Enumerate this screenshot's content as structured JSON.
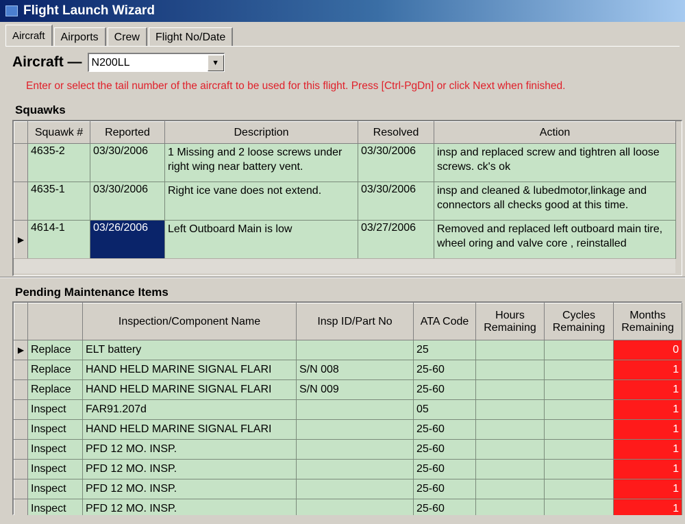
{
  "window": {
    "title": "Flight Launch Wizard"
  },
  "tabs": [
    {
      "label": "Aircraft"
    },
    {
      "label": "Airports"
    },
    {
      "label": "Crew"
    },
    {
      "label": "Flight No/Date"
    }
  ],
  "aircraft": {
    "label": "Aircraft —",
    "selected": "N200LL",
    "hint": "Enter or select the tail number of the aircraft to be used for this flight. Press [Ctrl-PgDn] or click Next when finished."
  },
  "squawks": {
    "title": "Squawks",
    "columns": [
      "Squawk #",
      "Reported",
      "Description",
      "Resolved",
      "Action"
    ],
    "rows": [
      {
        "id": "4635-2",
        "reported": "03/30/2006",
        "description": "1 Missing and 2 loose screws under right wing near battery vent.",
        "resolved": "03/30/2006",
        "action": "insp and replaced  screw and tightren all loose screws. ck's ok"
      },
      {
        "id": "4635-1",
        "reported": "03/30/2006",
        "description": "Right ice vane does not extend.",
        "resolved": "03/30/2006",
        "action": "insp and cleaned & lubedmotor,linkage and connectors all checks good at this time."
      },
      {
        "id": "4614-1",
        "reported": "03/26/2006",
        "description": "Left Outboard Main is low",
        "resolved": "03/27/2006",
        "action": "Removed and replaced left outboard main tire, wheel oring and valve core , reinstalled"
      }
    ]
  },
  "maintenance": {
    "title": "Pending Maintenance Items",
    "columns": [
      "",
      "Inspection/Component Name",
      "Insp ID/Part No",
      "ATA Code",
      "Hours Remaining",
      "Cycles Remaining",
      "Months Remaining"
    ],
    "rows": [
      {
        "type": "Replace",
        "name": "ELT battery",
        "part": "",
        "ata": "25",
        "hours": "",
        "cycles": "",
        "months": "0"
      },
      {
        "type": "Replace",
        "name": "HAND HELD MARINE SIGNAL FLARI",
        "part": "S/N 008",
        "ata": "25-60",
        "hours": "",
        "cycles": "",
        "months": "1"
      },
      {
        "type": "Replace",
        "name": "HAND HELD MARINE SIGNAL FLARI",
        "part": "S/N 009",
        "ata": "25-60",
        "hours": "",
        "cycles": "",
        "months": "1"
      },
      {
        "type": "Inspect",
        "name": "FAR91.207d",
        "part": "",
        "ata": "05",
        "hours": "",
        "cycles": "",
        "months": "1"
      },
      {
        "type": "Inspect",
        "name": "HAND HELD MARINE SIGNAL FLARI",
        "part": "",
        "ata": "25-60",
        "hours": "",
        "cycles": "",
        "months": "1"
      },
      {
        "type": "Inspect",
        "name": "PFD 12 MO. INSP.",
        "part": "",
        "ata": "25-60",
        "hours": "",
        "cycles": "",
        "months": "1"
      },
      {
        "type": "Inspect",
        "name": "PFD 12 MO. INSP.",
        "part": "",
        "ata": "25-60",
        "hours": "",
        "cycles": "",
        "months": "1"
      },
      {
        "type": "Inspect",
        "name": "PFD 12 MO. INSP.",
        "part": "",
        "ata": "25-60",
        "hours": "",
        "cycles": "",
        "months": "1"
      },
      {
        "type": "Inspect",
        "name": "PFD 12 MO. INSP.",
        "part": "",
        "ata": "25-60",
        "hours": "",
        "cycles": "",
        "months": "1"
      }
    ]
  },
  "colors": {
    "row_bg": "#c6e3c6",
    "alert": "#ff1a1a",
    "hint": "#e0202a",
    "selected": "#0a246a"
  }
}
